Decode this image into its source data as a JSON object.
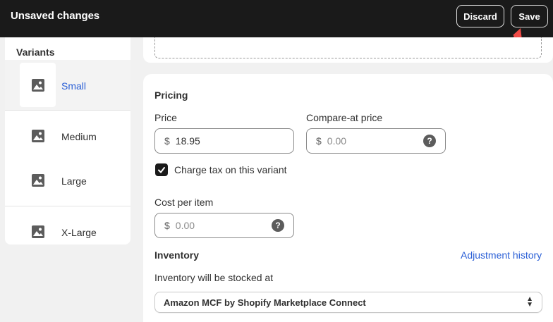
{
  "topbar": {
    "title": "Unsaved changes",
    "discard_label": "Discard",
    "save_label": "Save"
  },
  "sidebar": {
    "heading": "Variants",
    "variants": [
      {
        "label": "Small",
        "selected": true
      },
      {
        "label": "Medium",
        "selected": false
      },
      {
        "label": "Large",
        "selected": false
      },
      {
        "label": "X-Large",
        "selected": false
      }
    ]
  },
  "pricing": {
    "heading": "Pricing",
    "price_label": "Price",
    "price_prefix": "$",
    "price_value": "18.95",
    "compare_label": "Compare-at price",
    "compare_prefix": "$",
    "compare_placeholder": "0.00",
    "charge_tax_label": "Charge tax on this variant",
    "charge_tax_checked": true,
    "cost_label": "Cost per item",
    "cost_prefix": "$",
    "cost_placeholder": "0.00"
  },
  "inventory": {
    "heading": "Inventory",
    "adjustment_link": "Adjustment history",
    "stocked_label": "Inventory will be stocked at",
    "location_value": "Amazon MCF by Shopify Marketplace Connect"
  },
  "colors": {
    "topbar_bg": "#1a1a1a",
    "link_blue": "#2a5fd6",
    "arrow_red": "#f04a46"
  },
  "icons": {
    "variant_thumb": "image-placeholder-icon",
    "help": "question-circle-icon",
    "checkbox": "checkmark-icon",
    "select": "select-chevron-icon",
    "annotation": "red-arrow-icon"
  }
}
